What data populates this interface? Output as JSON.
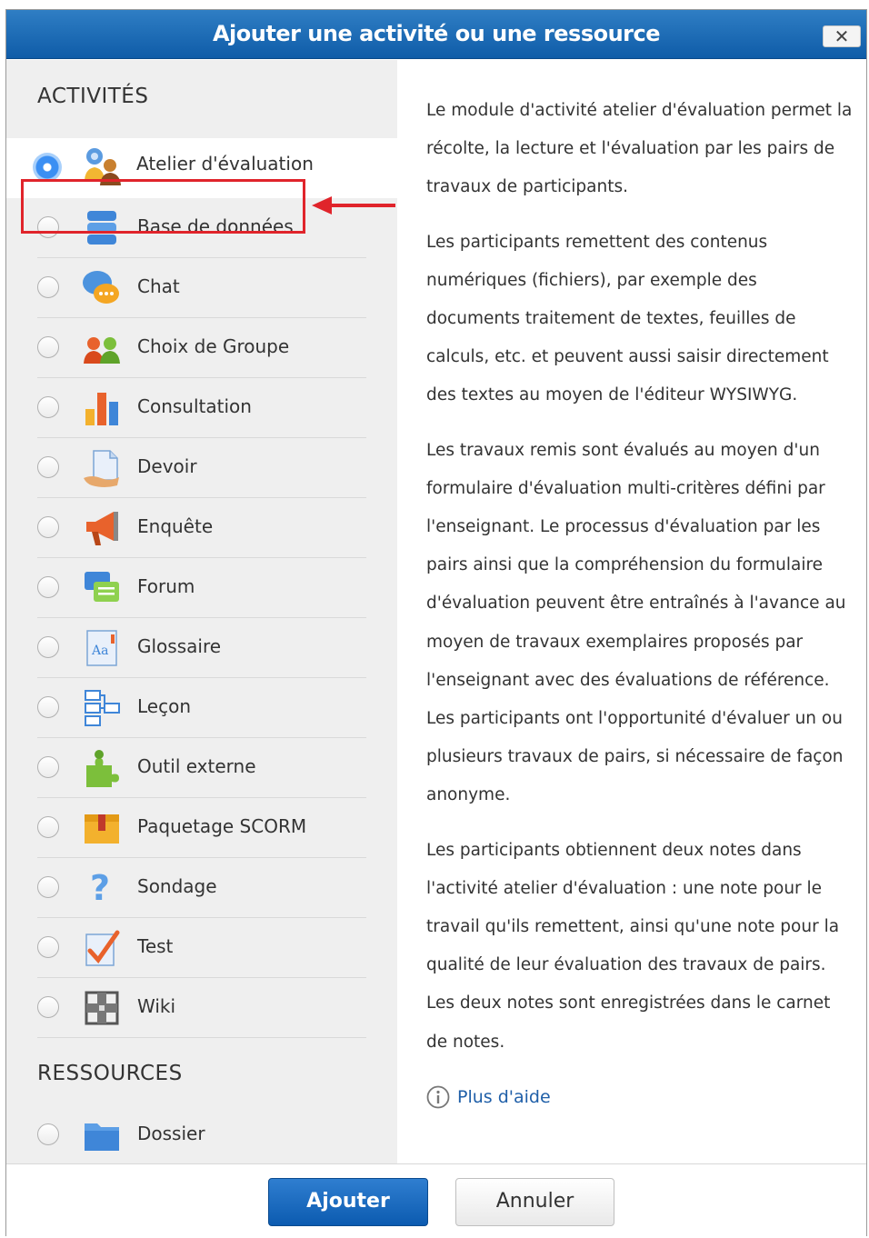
{
  "dialog": {
    "title": "Ajouter une activité ou une ressource",
    "close_label": "✕"
  },
  "activities": {
    "heading": "ACTIVITÉS",
    "items": [
      {
        "label": "Atelier d'évaluation",
        "icon": "workshop-icon",
        "selected": true
      },
      {
        "label": "Base de données",
        "icon": "database-icon",
        "selected": false
      },
      {
        "label": "Chat",
        "icon": "chat-icon",
        "selected": false
      },
      {
        "label": "Choix de Groupe",
        "icon": "group-choice-icon",
        "selected": false
      },
      {
        "label": "Consultation",
        "icon": "bar-chart-icon",
        "selected": false
      },
      {
        "label": "Devoir",
        "icon": "assignment-icon",
        "selected": false
      },
      {
        "label": "Enquête",
        "icon": "megaphone-icon",
        "selected": false
      },
      {
        "label": "Forum",
        "icon": "forum-icon",
        "selected": false
      },
      {
        "label": "Glossaire",
        "icon": "glossary-icon",
        "selected": false
      },
      {
        "label": "Leçon",
        "icon": "lesson-icon",
        "selected": false
      },
      {
        "label": "Outil externe",
        "icon": "puzzle-icon",
        "selected": false
      },
      {
        "label": "Paquetage SCORM",
        "icon": "package-icon",
        "selected": false
      },
      {
        "label": "Sondage",
        "icon": "question-icon",
        "selected": false
      },
      {
        "label": "Test",
        "icon": "quiz-check-icon",
        "selected": false
      },
      {
        "label": "Wiki",
        "icon": "wiki-icon",
        "selected": false
      }
    ]
  },
  "resources": {
    "heading": "RESSOURCES",
    "items": [
      {
        "label": "Dossier",
        "icon": "folder-icon",
        "selected": false
      }
    ]
  },
  "description": {
    "paragraphs": [
      "Le module d'activité atelier d'évaluation permet la récolte, la lecture et l'évaluation par les pairs de travaux de participants.",
      "Les participants remettent des contenus numériques (fichiers), par exemple des documents traitement de textes, feuilles de calculs, etc. et peuvent aussi saisir directement des textes au moyen de l'éditeur WYSIWYG.",
      "Les travaux remis sont évalués au moyen d'un formulaire d'évaluation multi-critères défini par l'enseignant. Le processus d'évaluation par les pairs ainsi que la compréhension du formulaire d'évaluation peuvent être entraînés à l'avance au moyen de travaux exemplaires proposés par l'enseignant avec des évaluations de référence. Les participants ont l'opportunité d'évaluer un ou plusieurs travaux de pairs, si nécessaire de façon anonyme.",
      "Les participants obtiennent deux notes dans l'activité atelier d'évaluation : une note pour le travail qu'ils remettent, ainsi qu'une note pour la qualité de leur évaluation des travaux de pairs. Les deux notes sont enregistrées dans le carnet de notes."
    ],
    "help_link": "Plus d'aide"
  },
  "footer": {
    "add_label": "Ajouter",
    "cancel_label": "Annuler"
  },
  "colors": {
    "title_bar": "#1466b5",
    "highlight": "#e0242b",
    "link": "#1f5fa8"
  }
}
